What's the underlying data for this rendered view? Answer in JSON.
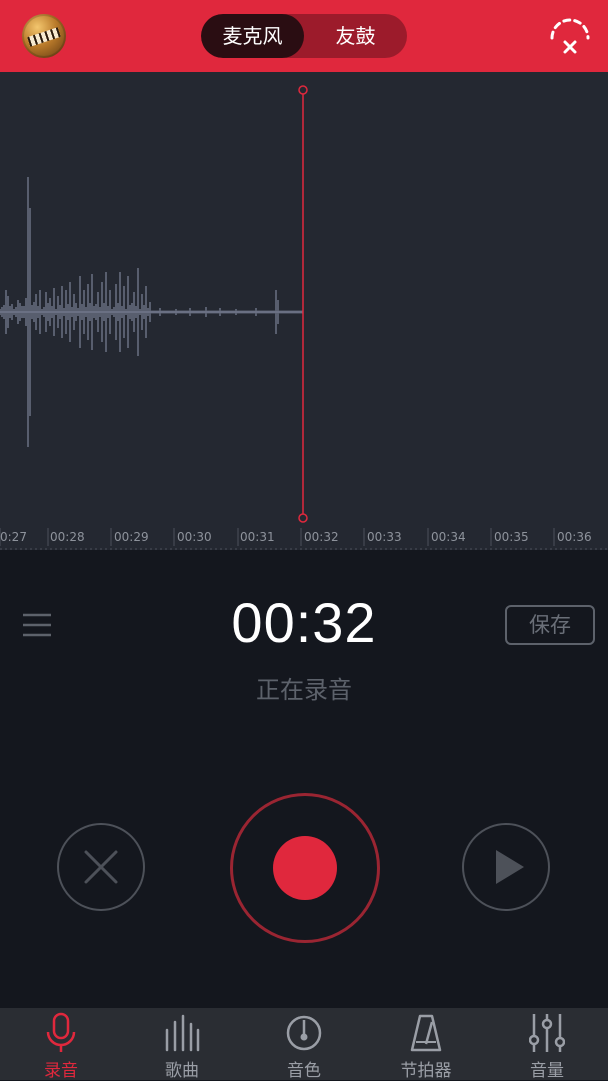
{
  "header": {
    "tabs": [
      {
        "label": "麦克风",
        "active": true
      },
      {
        "label": "友鼓",
        "active": false
      }
    ],
    "right_icon": "metronome-off-icon"
  },
  "timeline": {
    "ticks": [
      "0:27",
      "00:28",
      "00:29",
      "00:30",
      "00:31",
      "00:32",
      "00:33",
      "00:34",
      "00:35",
      "00:36"
    ]
  },
  "recorder": {
    "time": "00:32",
    "status": "正在录音",
    "save_label": "保存"
  },
  "nav": {
    "items": [
      {
        "label": "录音",
        "icon": "microphone-icon",
        "active": true
      },
      {
        "label": "歌曲",
        "icon": "song-bars-icon",
        "active": false
      },
      {
        "label": "音色",
        "icon": "tone-disc-icon",
        "active": false
      },
      {
        "label": "节拍器",
        "icon": "metronome-icon",
        "active": false
      },
      {
        "label": "音量",
        "icon": "volume-sliders-icon",
        "active": false
      }
    ]
  },
  "colors": {
    "accent": "#e0283d",
    "waveform": "#6a7083",
    "playhead": "#e0283d",
    "panel_bg": "#14171e",
    "wave_bg": "#242831"
  }
}
